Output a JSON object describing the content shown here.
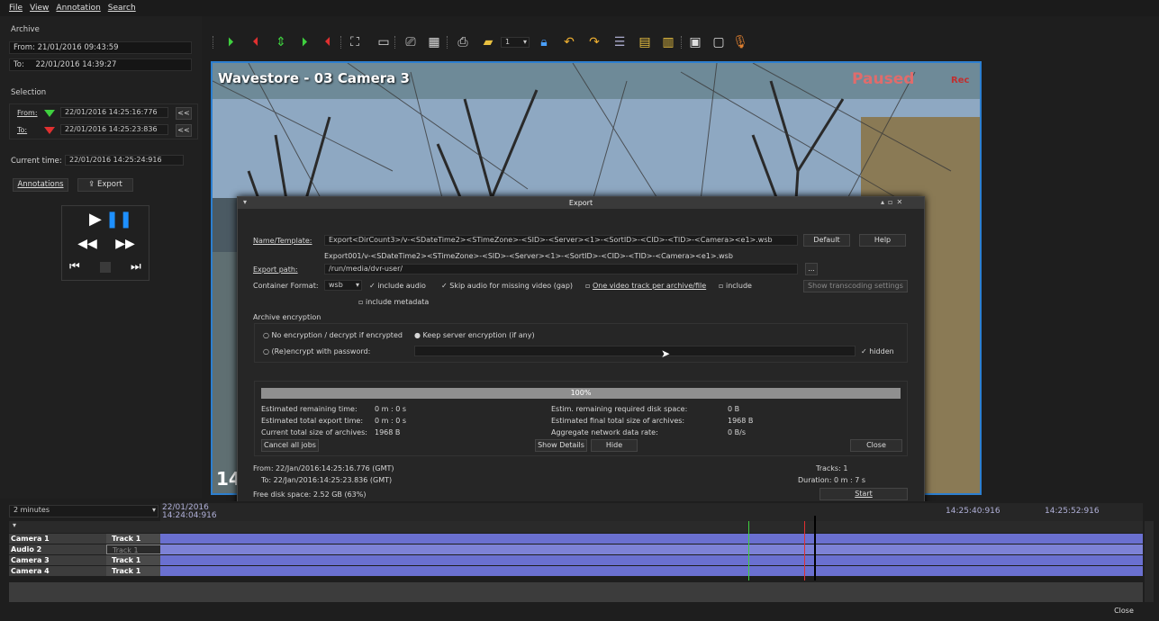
{
  "menu": {
    "items": [
      "File",
      "View",
      "Annotation",
      "Search"
    ]
  },
  "archive": {
    "label": "Archive",
    "from_label": "From:",
    "from_value": "21/01/2016 09:43:59",
    "to_label": "To:",
    "to_value": "22/01/2016 14:39:27"
  },
  "selection": {
    "label": "Selection",
    "from_label": "From:",
    "from_value": "22/01/2016 14:25:16:776",
    "to_label": "To:",
    "to_value": "22/01/2016 14:25:23:836",
    "rewind": "<<"
  },
  "current_time": {
    "label": "Current time:",
    "value": "22/01/2016 14:25:24:916"
  },
  "buttons": {
    "annotations": "Annotations",
    "export": "Export"
  },
  "toolbar": {
    "zoom_value": "1"
  },
  "video": {
    "title": "Wavestore - 03 Camera 3",
    "status": "Paused",
    "rec": "Rec",
    "time_prefix": "14"
  },
  "export_dialog": {
    "title": "Export",
    "name_template_label": "Name/Template:",
    "name_template_value": "Export<DirCount3>/v-<SDateTime2><STimeZone>-<SID>-<Server><1>-<SortID>-<CID>-<TID>-<Camera><e1>.wsb",
    "name_preview": "Export001/v-<SDateTime2><STimeZone>-<SID>-<Server><1>-<SortID>-<CID>-<TID>-<Camera><e1>.wsb",
    "default_button": "Default",
    "help_button": "Help",
    "export_path_label": "Export path:",
    "export_path_value": "/run/media/dvr-user/",
    "browse_button": "...",
    "container_label": "Container Format:",
    "container_value": "wsb",
    "include_audio": "include audio",
    "skip_audio": "Skip audio for missing video (gap)",
    "one_track": "One video track per archive/file",
    "include": "include",
    "transcoding_button": "Show transcoding settings",
    "include_metadata": "include metadata",
    "encryption_label": "Archive encryption",
    "no_encryption": "No encryption / decrypt if encrypted",
    "keep_encryption": "Keep server encryption (if any)",
    "reencrypt": "(Re)encrypt with password:",
    "hidden": "hidden",
    "progress_percent": "100%",
    "progress_fraction": 1.0,
    "est_remaining_time_label": "Estimated remaining time:",
    "est_remaining_time_value": "0 m : 0 s",
    "est_total_time_label": "Estimated total export time:",
    "est_total_time_value": "0 m : 0 s",
    "current_size_label": "Current total size of archives:",
    "current_size_value": "1968 B",
    "cancel_all": "Cancel all jobs",
    "est_disk_label": "Estim. remaining required disk space:",
    "est_disk_value": "0 B",
    "est_final_size_label": "Estimated final total size of archives:",
    "est_final_size_value": "1968 B",
    "net_rate_label": "Aggregate network data rate:",
    "net_rate_value": "0 B/s",
    "show_details": "Show Details",
    "hide": "Hide",
    "close": "Close",
    "from_text": "From: 22/Jan/2016:14:25:16.776 (GMT)",
    "to_text": "To: 22/Jan/2016:14:25:23.836 (GMT)",
    "free_disk": "Free disk space: 2.52 GB (63%)",
    "tracks": "Tracks: 1",
    "duration": "Duration: 0 m : 7 s",
    "start": "Start"
  },
  "timeline": {
    "range": "2 minutes",
    "start_date": "22/01/2016",
    "start_time": "14:24:04:916",
    "tick1": "14:25:40:916",
    "tick2": "14:25:52:916",
    "tracks": [
      {
        "name": "Camera 1",
        "track": "Track 1"
      },
      {
        "name": "Audio 2",
        "track": "Track 1"
      },
      {
        "name": "Camera 3",
        "track": "Track 1"
      },
      {
        "name": "Camera 4",
        "track": "Track 1"
      }
    ],
    "close_button": "Close"
  }
}
